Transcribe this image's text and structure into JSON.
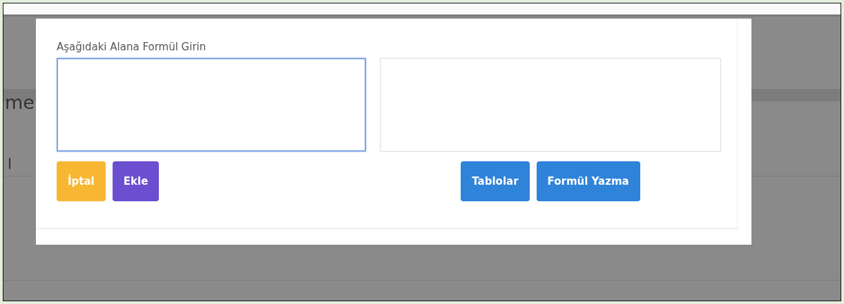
{
  "background_text": [
    "me",
    "l"
  ],
  "dialog": {
    "label": "Aşağıdaki Alana Formül Girin",
    "fields": [
      {
        "focused": true
      },
      {
        "focused": false
      }
    ],
    "left_buttons": [
      {
        "label": "İptal",
        "kind": "warning"
      },
      {
        "label": "Ekle",
        "kind": "purple"
      }
    ],
    "right_buttons": [
      {
        "label": "Tablolar",
        "kind": "primary"
      },
      {
        "label": "Formül Yazma",
        "kind": "primary"
      }
    ]
  }
}
